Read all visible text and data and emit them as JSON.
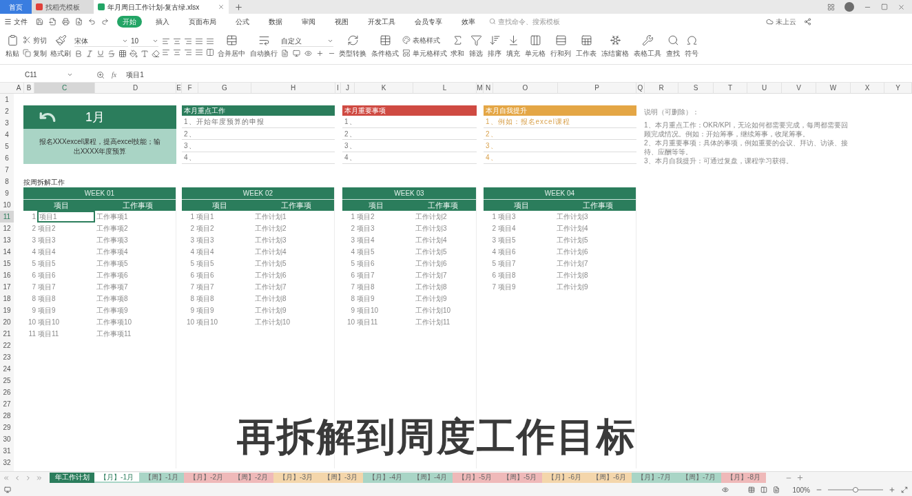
{
  "title_bar": {
    "tabs": [
      {
        "label": "首页",
        "kind": "home",
        "selected": false
      },
      {
        "label": "找稻壳模板",
        "kind": "template",
        "selected": false
      },
      {
        "label": "年月周日工作计划-复古绿.xlsx",
        "kind": "sheet",
        "selected": true
      }
    ]
  },
  "menu": {
    "file": "文件",
    "items": [
      {
        "label": "开始",
        "selected": true
      },
      {
        "label": "插入",
        "selected": false
      },
      {
        "label": "页面布局",
        "selected": false
      },
      {
        "label": "公式",
        "selected": false
      },
      {
        "label": "数据",
        "selected": false
      },
      {
        "label": "审阅",
        "selected": false
      },
      {
        "label": "视图",
        "selected": false
      },
      {
        "label": "开发工具",
        "selected": false
      },
      {
        "label": "会员专享",
        "selected": false
      },
      {
        "label": "效率",
        "selected": false
      }
    ],
    "search": {
      "placeholder": "查找命令、搜索模板"
    },
    "cloud": "未上云"
  },
  "ribbon": [
    {
      "kind": "big",
      "label": "粘贴"
    },
    {
      "kind": "pair",
      "labels": [
        "剪切",
        "复制"
      ]
    },
    {
      "kind": "big",
      "label": "格式刷"
    },
    {
      "kind": "font",
      "font": "宋体",
      "size": "10"
    },
    {
      "kind": "align"
    },
    {
      "kind": "big",
      "label": "合并居中"
    },
    {
      "kind": "big",
      "label": "自动换行"
    },
    {
      "kind": "number",
      "format": "自定义"
    },
    {
      "kind": "big",
      "label": "类型转换"
    },
    {
      "kind": "big",
      "label": "条件格式"
    },
    {
      "kind": "pair",
      "labels": [
        "表格样式",
        "单元格样式"
      ]
    },
    {
      "kind": "big",
      "label": "求和"
    },
    {
      "kind": "big",
      "label": "筛选"
    },
    {
      "kind": "big",
      "label": "排序"
    },
    {
      "kind": "big",
      "label": "填充"
    },
    {
      "kind": "big",
      "label": "单元格"
    },
    {
      "kind": "big",
      "label": "行和列"
    },
    {
      "kind": "big",
      "label": "工作表"
    },
    {
      "kind": "big",
      "label": "冻结窗格"
    },
    {
      "kind": "big",
      "label": "表格工具"
    },
    {
      "kind": "big",
      "label": "查找"
    },
    {
      "kind": "big",
      "label": "符号"
    }
  ],
  "formula_bar": {
    "cell": "C11",
    "fx": "fx",
    "value": "项目1"
  },
  "column_headers": [
    {
      "label": "A",
      "selected": false
    },
    {
      "label": "B",
      "selected": false
    },
    {
      "label": "C",
      "selected": true
    },
    {
      "label": "D",
      "selected": false
    },
    {
      "label": "E",
      "selected": false
    },
    {
      "label": "F",
      "selected": false
    },
    {
      "label": "G",
      "selected": false
    },
    {
      "label": "H",
      "selected": false
    },
    {
      "label": "I",
      "selected": false
    },
    {
      "label": "J",
      "selected": false
    },
    {
      "label": "K",
      "selected": false
    },
    {
      "label": "L",
      "selected": false
    },
    {
      "label": "M",
      "selected": false
    },
    {
      "label": "N",
      "selected": false
    },
    {
      "label": "O",
      "selected": false
    },
    {
      "label": "P",
      "selected": false
    },
    {
      "label": "Q",
      "selected": false
    },
    {
      "label": "R",
      "selected": false
    },
    {
      "label": "S",
      "selected": false
    },
    {
      "label": "T",
      "selected": false
    },
    {
      "label": "U",
      "selected": false
    },
    {
      "label": "V",
      "selected": false
    },
    {
      "label": "W",
      "selected": false
    },
    {
      "label": "X",
      "selected": false
    },
    {
      "label": "Y",
      "selected": false
    }
  ],
  "row_headers": [
    {
      "label": "1",
      "selected": false
    },
    {
      "label": "2",
      "selected": false
    },
    {
      "label": "3",
      "selected": false
    },
    {
      "label": "4",
      "selected": false
    },
    {
      "label": "5",
      "selected": false
    },
    {
      "label": "6",
      "selected": false
    },
    {
      "label": "7",
      "selected": false
    },
    {
      "label": "8",
      "selected": false
    },
    {
      "label": "9",
      "selected": false
    },
    {
      "label": "10",
      "selected": false
    },
    {
      "label": "11",
      "selected": true
    },
    {
      "label": "12",
      "selected": false
    },
    {
      "label": "13",
      "selected": false
    },
    {
      "label": "14",
      "selected": false
    },
    {
      "label": "15",
      "selected": false
    },
    {
      "label": "16",
      "selected": false
    },
    {
      "label": "17",
      "selected": false
    },
    {
      "label": "18",
      "selected": false
    },
    {
      "label": "19",
      "selected": false
    },
    {
      "label": "20",
      "selected": false
    },
    {
      "label": "21",
      "selected": false
    },
    {
      "label": "22",
      "selected": false
    },
    {
      "label": "23",
      "selected": false
    },
    {
      "label": "24",
      "selected": false
    },
    {
      "label": "25",
      "selected": false
    },
    {
      "label": "26",
      "selected": false
    },
    {
      "label": "27",
      "selected": false
    },
    {
      "label": "28",
      "selected": false
    },
    {
      "label": "29",
      "selected": false
    },
    {
      "label": "30",
      "selected": false
    },
    {
      "label": "31",
      "selected": false
    },
    {
      "label": "32",
      "selected": false
    }
  ],
  "month_card": {
    "title": "1月",
    "goal": "报名XXXexcel课程，提高excel技能；输出XXXX年度预算"
  },
  "panels": [
    {
      "title": "本月重点工作",
      "color": "#2b7d5c",
      "items": [
        "1、开始年度预算的申报",
        "2、",
        "3、",
        "4、"
      ]
    },
    {
      "title": "本月重要事项",
      "color": "#cf4a42",
      "items": [
        "1、",
        "2、",
        "3、",
        "4、"
      ]
    },
    {
      "title": "本月自我提升",
      "color": "#e4a645",
      "items": [
        "1、例如：报名excel课程",
        "2、",
        "3、",
        "4、"
      ]
    }
  ],
  "notes": {
    "title": "说明（可删除）：",
    "paragraphs": [
      "1、本月重点工作：OKR/KPI，无论如何都需要完成，每周都需要回顾完成情况。例如：开始筹事，继续筹事，收尾筹事。",
      "2、本月重要事项：具体的事项，例如重要的会议、拜访、访谈、接待、应酬等等。",
      "3、本月自我提升：可通过复盘，课程学习获得。"
    ]
  },
  "section_label": "按周拆解工作",
  "weeks": [
    {
      "title": "WEEK 01",
      "columns": [
        "项目",
        "工作事项"
      ],
      "rows": [
        {
          "no": "1",
          "item": "项目1",
          "task": "工作事项1",
          "selected": true
        },
        {
          "no": "2",
          "item": "项目2",
          "task": "工作事项2",
          "selected": false
        },
        {
          "no": "3",
          "item": "项目3",
          "task": "工作事项3",
          "selected": false
        },
        {
          "no": "4",
          "item": "项目4",
          "task": "工作事项4",
          "selected": false
        },
        {
          "no": "5",
          "item": "项目5",
          "task": "工作事项5",
          "selected": false
        },
        {
          "no": "6",
          "item": "项目6",
          "task": "工作事项6",
          "selected": false
        },
        {
          "no": "7",
          "item": "项目7",
          "task": "工作事项7",
          "selected": false
        },
        {
          "no": "8",
          "item": "项目8",
          "task": "工作事项8",
          "selected": false
        },
        {
          "no": "9",
          "item": "项目9",
          "task": "工作事项9",
          "selected": false
        },
        {
          "no": "10",
          "item": "项目10",
          "task": "工作事项10",
          "selected": false
        },
        {
          "no": "11",
          "item": "项目11",
          "task": "工作事项11",
          "selected": false
        }
      ]
    },
    {
      "title": "WEEK 02",
      "columns": [
        "项目",
        "工作事项"
      ],
      "rows": [
        {
          "no": "1",
          "item": "项目1",
          "task": "工作计划1",
          "selected": false
        },
        {
          "no": "2",
          "item": "项目2",
          "task": "工作计划2",
          "selected": false
        },
        {
          "no": "3",
          "item": "项目3",
          "task": "工作计划3",
          "selected": false
        },
        {
          "no": "4",
          "item": "项目4",
          "task": "工作计划4",
          "selected": false
        },
        {
          "no": "5",
          "item": "项目5",
          "task": "工作计划5",
          "selected": false
        },
        {
          "no": "6",
          "item": "项目6",
          "task": "工作计划6",
          "selected": false
        },
        {
          "no": "7",
          "item": "项目7",
          "task": "工作计划7",
          "selected": false
        },
        {
          "no": "8",
          "item": "项目8",
          "task": "工作计划8",
          "selected": false
        },
        {
          "no": "9",
          "item": "项目9",
          "task": "工作计划9",
          "selected": false
        },
        {
          "no": "10",
          "item": "项目10",
          "task": "工作计划10",
          "selected": false
        }
      ]
    },
    {
      "title": "WEEK 03",
      "columns": [
        "项目",
        "工作事项"
      ],
      "rows": [
        {
          "no": "1",
          "item": "项目2",
          "task": "工作计划2",
          "selected": false
        },
        {
          "no": "2",
          "item": "项目3",
          "task": "工作计划3",
          "selected": false
        },
        {
          "no": "3",
          "item": "项目4",
          "task": "工作计划4",
          "selected": false
        },
        {
          "no": "4",
          "item": "项目5",
          "task": "工作计划5",
          "selected": false
        },
        {
          "no": "5",
          "item": "项目6",
          "task": "工作计划6",
          "selected": false
        },
        {
          "no": "6",
          "item": "项目7",
          "task": "工作计划7",
          "selected": false
        },
        {
          "no": "7",
          "item": "项目8",
          "task": "工作计划8",
          "selected": false
        },
        {
          "no": "8",
          "item": "项目9",
          "task": "工作计划9",
          "selected": false
        },
        {
          "no": "9",
          "item": "项目10",
          "task": "工作计划10",
          "selected": false
        },
        {
          "no": "10",
          "item": "项目11",
          "task": "工作计划11",
          "selected": false
        }
      ]
    },
    {
      "title": "WEEK 04",
      "columns": [
        "项目",
        "工作事项"
      ],
      "rows": [
        {
          "no": "1",
          "item": "项目3",
          "task": "工作计划3",
          "selected": false
        },
        {
          "no": "2",
          "item": "项目4",
          "task": "工作计划4",
          "selected": false
        },
        {
          "no": "3",
          "item": "项目5",
          "task": "工作计划5",
          "selected": false
        },
        {
          "no": "4",
          "item": "项目6",
          "task": "工作计划6",
          "selected": false
        },
        {
          "no": "5",
          "item": "项目7",
          "task": "工作计划7",
          "selected": false
        },
        {
          "no": "6",
          "item": "项目8",
          "task": "工作计划8",
          "selected": false
        },
        {
          "no": "7",
          "item": "项目9",
          "task": "工作计划9",
          "selected": false
        }
      ]
    }
  ],
  "caption": "再拆解到周度工作目标",
  "sheet_tabs": [
    {
      "label": "年工作计划",
      "color": "#2b7d5c",
      "selected": false
    },
    {
      "label": "【月】-1月",
      "color": "#a9d5c6",
      "selected": true
    },
    {
      "label": "【周】-1月",
      "color": "#a9d5c6",
      "selected": false
    },
    {
      "label": "【月】-2月",
      "color": "#efb9b9",
      "selected": false
    },
    {
      "label": "【周】-2月",
      "color": "#efb9b9",
      "selected": false
    },
    {
      "label": "【月】-3月",
      "color": "#f4d6ab",
      "selected": false
    },
    {
      "label": "【周】-3月",
      "color": "#f4d6ab",
      "selected": false
    },
    {
      "label": "【月】-4月",
      "color": "#a9d5c6",
      "selected": false
    },
    {
      "label": "【周】-4月",
      "color": "#a9d5c6",
      "selected": false
    },
    {
      "label": "【月】-5月",
      "color": "#efb9b9",
      "selected": false
    },
    {
      "label": "【周】-5月",
      "color": "#efb9b9",
      "selected": false
    },
    {
      "label": "【月】-6月",
      "color": "#f4d6ab",
      "selected": false
    },
    {
      "label": "【周】-6月",
      "color": "#f4d6ab",
      "selected": false
    },
    {
      "label": "【月】-7月",
      "color": "#a9d5c6",
      "selected": false
    },
    {
      "label": "【周】-7月",
      "color": "#a9d5c6",
      "selected": false
    },
    {
      "label": "【月】-8月",
      "color": "#efb9b9",
      "selected": false
    }
  ],
  "status_bar": {
    "zoom": "100%",
    "zoom_slider": {
      "level": 0.5
    }
  }
}
